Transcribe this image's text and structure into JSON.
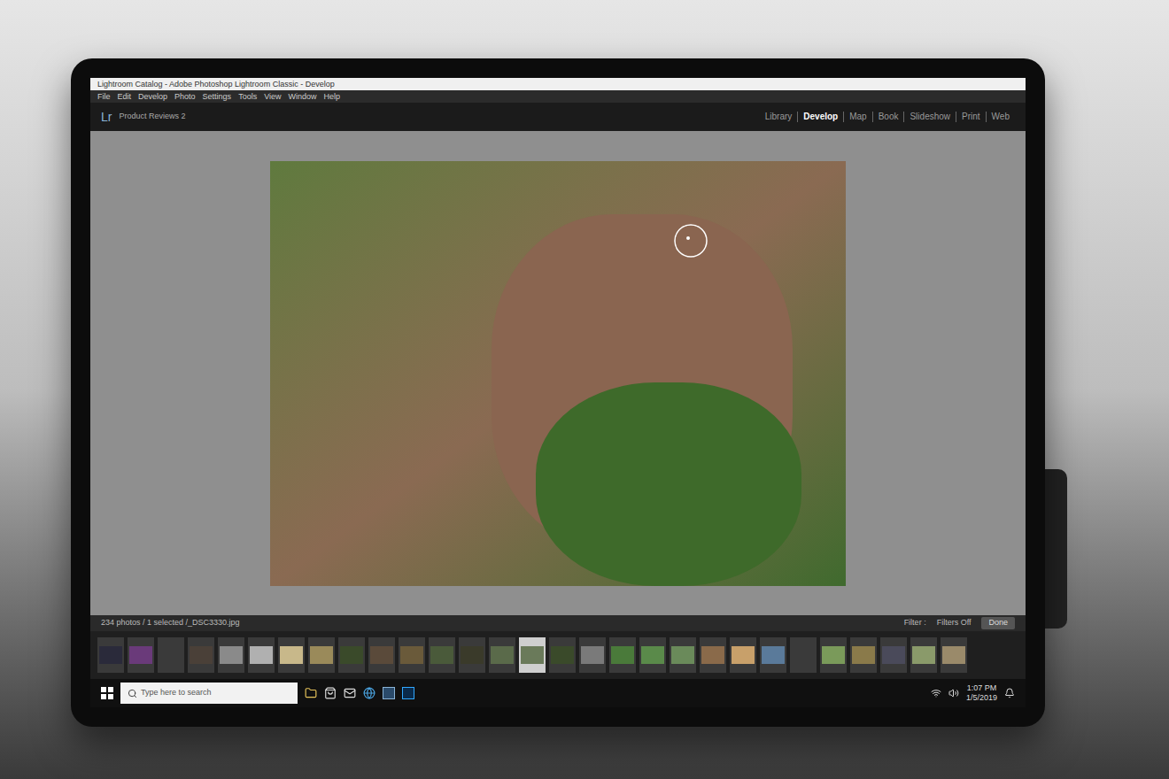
{
  "window": {
    "title": "Lightroom Catalog - Adobe Photoshop Lightroom Classic - Develop"
  },
  "menu": [
    "File",
    "Edit",
    "Develop",
    "Photo",
    "Settings",
    "Tools",
    "View",
    "Window",
    "Help"
  ],
  "header": {
    "logo": "Lr",
    "catalog": "Product Reviews 2"
  },
  "modules": [
    {
      "label": "Library",
      "selected": false
    },
    {
      "label": "Develop",
      "selected": true
    },
    {
      "label": "Map",
      "selected": false
    },
    {
      "label": "Book",
      "selected": false
    },
    {
      "label": "Slideshow",
      "selected": false
    },
    {
      "label": "Print",
      "selected": false
    },
    {
      "label": "Web",
      "selected": false
    }
  ],
  "filmstrip": {
    "info": "234 photos / 1 selected /_DSC3330.jpg",
    "done": "Done",
    "filter_label": "Filter :",
    "filter_value": "Filters Off",
    "thumbnails": [
      {
        "color": "#2a2a3a",
        "selected": false
      },
      {
        "color": "#6a3a7a",
        "selected": false
      },
      {
        "color": "#3a3a3a",
        "selected": false
      },
      {
        "color": "#4a4038",
        "selected": false
      },
      {
        "color": "#8a8a8a",
        "selected": false
      },
      {
        "color": "#b0b0b0",
        "selected": false
      },
      {
        "color": "#c8b88a",
        "selected": false
      },
      {
        "color": "#9a8a5a",
        "selected": false
      },
      {
        "color": "#3a4a2a",
        "selected": false
      },
      {
        "color": "#5a4a3a",
        "selected": false
      },
      {
        "color": "#6a5a3a",
        "selected": false
      },
      {
        "color": "#4a5a3a",
        "selected": false
      },
      {
        "color": "#3a3a2a",
        "selected": false
      },
      {
        "color": "#5a6a4a",
        "selected": false
      },
      {
        "color": "#6a7a5a",
        "selected": true
      },
      {
        "color": "#3a4a2a",
        "selected": false
      },
      {
        "color": "#7a7a7a",
        "selected": false
      },
      {
        "color": "#4a7a3a",
        "selected": false
      },
      {
        "color": "#5a8a4a",
        "selected": false
      },
      {
        "color": "#6a8a5a",
        "selected": false
      },
      {
        "color": "#8a6a4a",
        "selected": false
      },
      {
        "color": "#c8a06a",
        "selected": false
      },
      {
        "color": "#5a7a9a",
        "selected": false
      },
      {
        "color": "#3a3a3a",
        "selected": false
      },
      {
        "color": "#7a9a5a",
        "selected": false
      },
      {
        "color": "#8a7a4a",
        "selected": false
      },
      {
        "color": "#4a4a5a",
        "selected": false
      },
      {
        "color": "#8a9a6a",
        "selected": false
      },
      {
        "color": "#9a8a6a",
        "selected": false
      }
    ]
  },
  "taskbar": {
    "search_placeholder": "Type here to search",
    "time": "1:07 PM",
    "date": "1/5/2019"
  }
}
